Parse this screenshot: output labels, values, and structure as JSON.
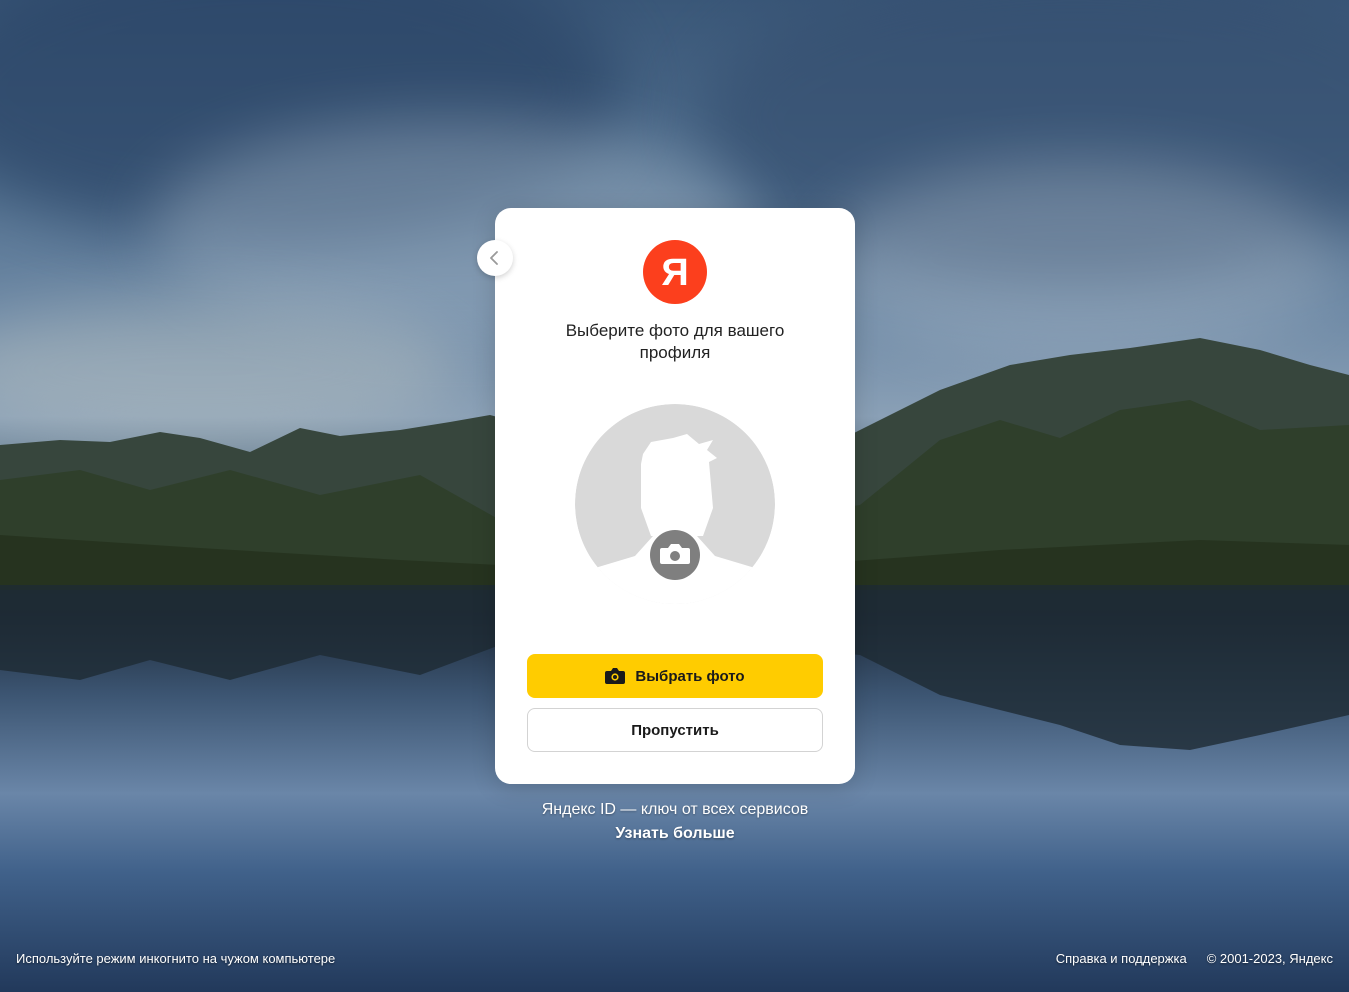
{
  "card": {
    "logo_letter": "Я",
    "title": "Выберите фото для вашего профиля",
    "choose_photo_label": "Выбрать фото",
    "skip_label": "Пропустить"
  },
  "promo": {
    "text": "Яндекс ID — ключ от всех сервисов",
    "link": "Узнать больше"
  },
  "footer": {
    "incognito_hint": "Используйте режим инкогнито на чужом компьютере",
    "help_link": "Справка и поддержка",
    "copyright": "© 2001-2023, Яндекс"
  },
  "colors": {
    "brand_red": "#fc3f1d",
    "button_yellow": "#ffcc00",
    "avatar_gray": "#d9d9d9"
  },
  "icons": {
    "back": "chevron-left-icon",
    "camera": "camera-icon",
    "avatar": "user-silhouette-icon"
  }
}
